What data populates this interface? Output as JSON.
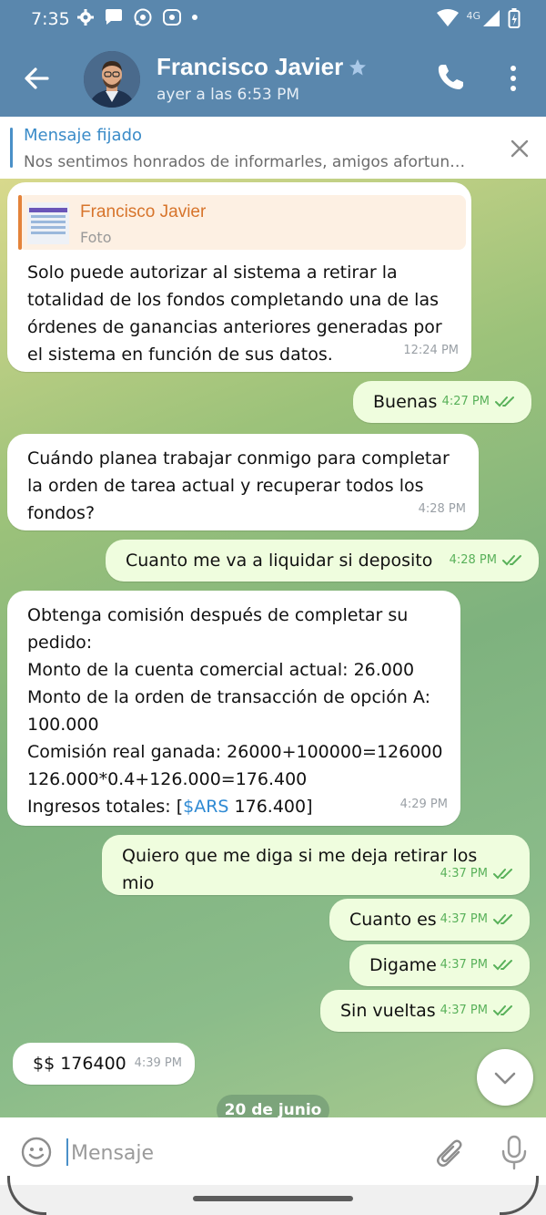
{
  "status_bar": {
    "time": "7:35",
    "network": "4G"
  },
  "header": {
    "name": "Francisco Javier",
    "last_seen": "ayer a las 6:53 PM"
  },
  "pinned": {
    "title": "Mensaje fijado",
    "text": "Nos sentimos honrados de informarles, amigos afortun…"
  },
  "messages": [
    {
      "direction": "in",
      "reply": {
        "name": "Francisco Javier",
        "label": "Foto"
      },
      "text": "Solo puede autorizar al sistema a retirar la\ntotalidad de los fondos completando una de las\nórdenes de ganancias anteriores generadas por\nel sistema en función de sus datos.",
      "time": "12:24 PM"
    },
    {
      "direction": "out",
      "text": "Buenas",
      "time": "4:27 PM"
    },
    {
      "direction": "in",
      "text": "Cuándo planea trabajar conmigo para completar\nla orden de tarea actual y recuperar todos los\nfondos?",
      "time": "4:28 PM"
    },
    {
      "direction": "out",
      "text": "Cuanto me va a liquidar si deposito",
      "time": "4:28 PM"
    },
    {
      "direction": "in",
      "text_pre": "Obtenga comisión después de completar su\npedido:\nMonto de la cuenta comercial actual: 26.000\nMonto de la orden de transacción de opción A:\n100.000\nComisión real ganada: 26000+100000=126000\n126.000*0.4+126.000=176.400\nIngresos totales: [",
      "link": "$ARS",
      "text_post": " 176.400]",
      "time": "4:29 PM"
    },
    {
      "direction": "out",
      "text": "Quiero que me diga si me deja retirar los mio",
      "time": "4:37 PM"
    },
    {
      "direction": "out",
      "text": "Cuanto es",
      "time": "4:37 PM"
    },
    {
      "direction": "out",
      "text": "Digame",
      "time": "4:37 PM"
    },
    {
      "direction": "out",
      "text": "Sin vueltas",
      "time": "4:37 PM"
    },
    {
      "direction": "in",
      "text": "$$ 176400",
      "time": "4:39 PM"
    }
  ],
  "date_divider": "20 de junio",
  "input": {
    "placeholder": "Mensaje"
  },
  "colors": {
    "header": "#5a87ad",
    "outgoing_bubble": "#effdde",
    "incoming_bubble": "#ffffff",
    "accent": "#3a8bc8",
    "reply_name": "#d7742b",
    "read_check": "#59b15a"
  },
  "icons": [
    "settings-icon",
    "message-icon",
    "whatsapp-icon",
    "app-icon",
    "wifi-icon",
    "signal-icon",
    "battery-icon",
    "back-arrow-icon",
    "star-icon",
    "phone-icon",
    "more-vert-icon",
    "close-icon",
    "double-check-icon",
    "chevron-down-icon",
    "emoji-icon",
    "attach-icon",
    "mic-icon"
  ]
}
